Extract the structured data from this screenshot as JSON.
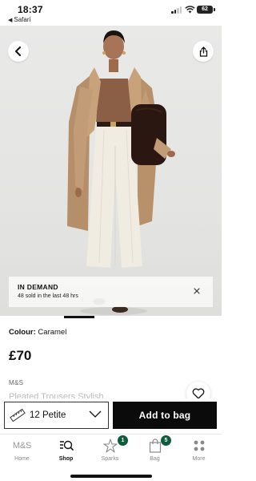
{
  "status_bar": {
    "time": "18:37",
    "back_app": "Safari",
    "battery": "62"
  },
  "product": {
    "badge": {
      "title": "IN DEMAND",
      "subtitle": "48 sold in the last 48 hrs"
    },
    "colour_label": "Colour:",
    "colour_value": "Caramel",
    "price": "£70",
    "brand": "M&S",
    "name_partial": "Pleated Trousers Stylish"
  },
  "purchase": {
    "size": "12 Petite",
    "add_to_bag": "Add to bag"
  },
  "tabs": [
    {
      "label": "Home"
    },
    {
      "label": "Shop"
    },
    {
      "label": "Sparks",
      "badge": "1"
    },
    {
      "label": "Bag",
      "badge": "5"
    },
    {
      "label": "More"
    }
  ],
  "home_logo": "M&S",
  "colors": {
    "accent_green": "#0f5c3b",
    "coat": "#c29c76",
    "trousers": "#f1ece1"
  }
}
